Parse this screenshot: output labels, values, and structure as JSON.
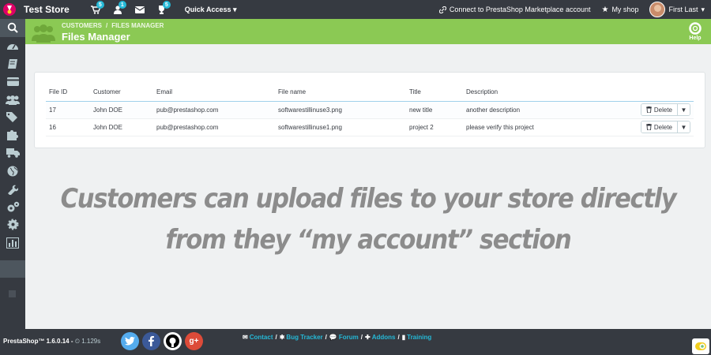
{
  "topbar": {
    "store_name": "Test Store",
    "notifications": [
      {
        "icon": "cart-icon",
        "count": "5"
      },
      {
        "icon": "user-icon",
        "count": "1"
      },
      {
        "icon": "envelope-icon",
        "count": ""
      },
      {
        "icon": "trophy-icon",
        "count": "5"
      }
    ],
    "quick_access": "Quick Access",
    "connect": "Connect to PrestaShop Marketplace account",
    "my_shop": "My shop",
    "user_name": "First Last"
  },
  "header": {
    "breadcrumb": [
      "CUSTOMERS",
      "FILES MANAGER"
    ],
    "title": "Files Manager",
    "help": "Help"
  },
  "table": {
    "columns": [
      "File ID",
      "Customer",
      "Email",
      "File name",
      "Title",
      "Description"
    ],
    "rows": [
      {
        "id": "17",
        "customer": "John DOE",
        "email": "pub@prestashop.com",
        "file": "softwarestillinuse3.png",
        "title": "new title",
        "description": "another description",
        "action": "Delete"
      },
      {
        "id": "16",
        "customer": "John DOE",
        "email": "pub@prestashop.com",
        "file": "softwarestillinuse1.png",
        "title": "project 2",
        "description": "please verify this project",
        "action": "Delete"
      }
    ]
  },
  "caption": {
    "line1": "Customers can upload files to your store directly",
    "line2": "from they “my account” section"
  },
  "footer": {
    "version": "PrestaShop™ 1.6.0.14 -",
    "time": "1.129s",
    "links": [
      "Contact",
      "Bug Tracker",
      "Forum",
      "Addons",
      "Training"
    ]
  },
  "colors": {
    "header_green": "#8bc954",
    "dark_bar": "#363a41",
    "link_blue": "#25b9d7"
  }
}
